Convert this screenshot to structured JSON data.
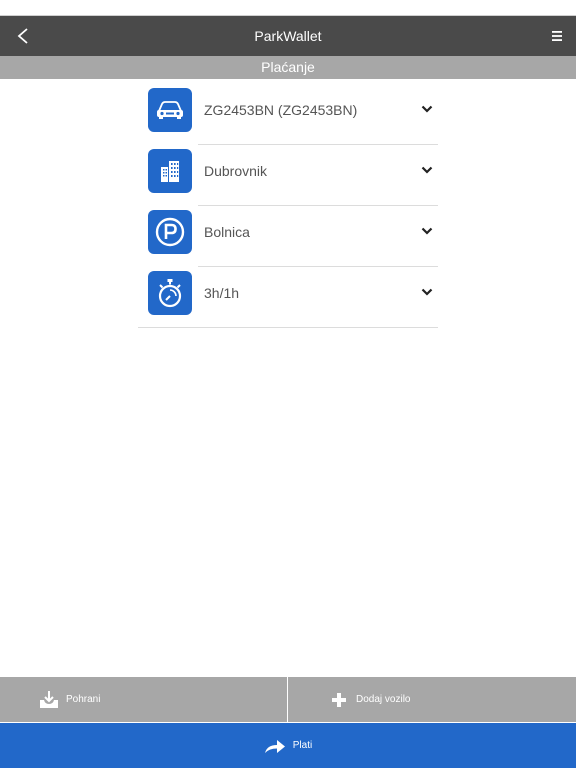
{
  "app": {
    "title": "ParkWallet",
    "section": "Plaćanje"
  },
  "colors": {
    "navbar": "#4a4a4a",
    "subheader": "#a7a7a7",
    "accent": "#2268c9",
    "text": "#555555"
  },
  "rows": [
    {
      "icon": "car-icon",
      "value": "ZG2453BN (ZG2453BN)"
    },
    {
      "icon": "city-buildings-icon",
      "value": "Dubrovnik"
    },
    {
      "icon": "parking-icon",
      "value": "Bolnica"
    },
    {
      "icon": "stopwatch-icon",
      "value": "3h/1h"
    }
  ],
  "actions": {
    "save_label": "Pohrani",
    "add_vehicle_label": "Dodaj vozilo",
    "pay_label": "Plati"
  }
}
